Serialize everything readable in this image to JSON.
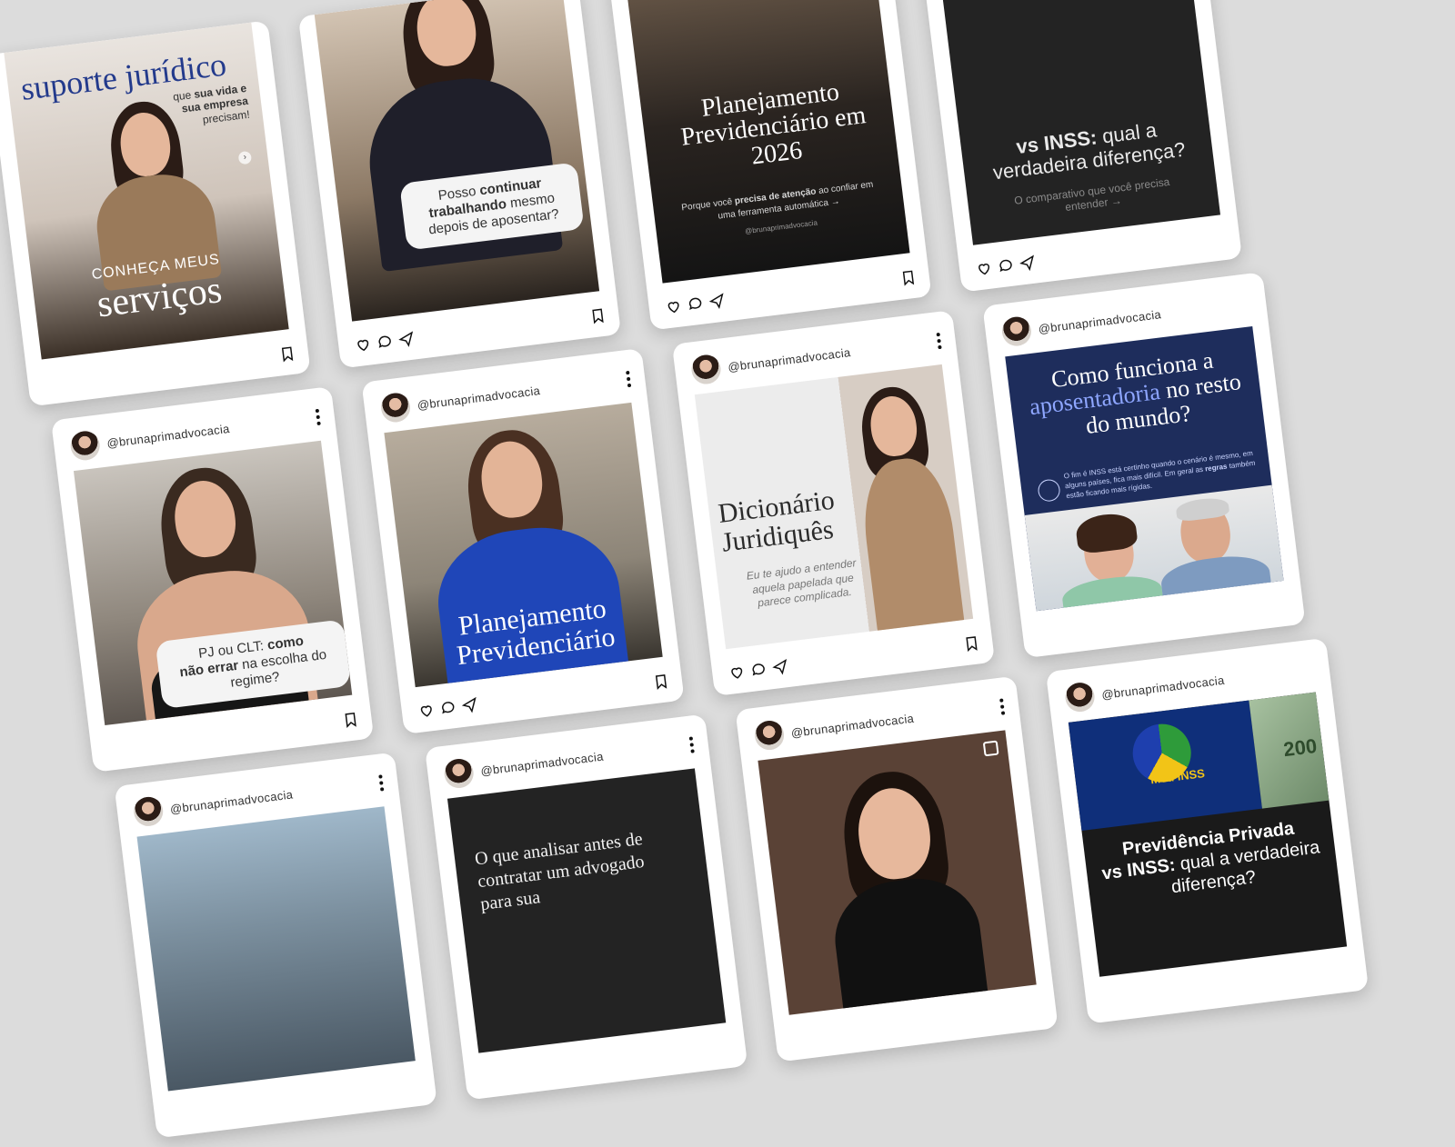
{
  "handle": "@brunaprimadvocacia",
  "colors": {
    "background": "#dcdcdc",
    "card": "#ffffff",
    "navy": "#1e2d5c",
    "dark": "#232323",
    "highlight": "#8ea6ff"
  },
  "icons": [
    "heart-icon",
    "comment-icon",
    "share-icon",
    "bookmark-icon",
    "more-icon",
    "carousel-icon",
    "globe-icon"
  ],
  "posts": {
    "p1": {
      "title": "suporte jurídico",
      "sub_lead": "que ",
      "sub_bold": "sua vida e sua empresa",
      "sub_tail": " precisam!",
      "caption_small": "CONHEÇA MEUS",
      "caption_big": "serviços"
    },
    "p2": {
      "q1": "Posso ",
      "q2": "continuar trabalhando",
      "q3": " mesmo depois de aposentar?"
    },
    "p3": {
      "title": "Planejamento Previdenciário em 2026",
      "sub_lead": "Porque você ",
      "sub_bold": "precisa de atenção",
      "sub_tail": " ao confiar em uma ferramenta automática →",
      "credit": "@brunaprimadvocacia"
    },
    "p4": {
      "title_bold": "vs INSS:",
      "title_rest": " qual a verdadeira diferença?",
      "sub": "O comparativo que você precisa entender →"
    },
    "p5": {
      "q_lead": "PJ ou CLT: ",
      "q_bold1": "como",
      "q_bold2": "não errar",
      "q_tail": " na escolha do regime?"
    },
    "p6": {
      "caption": "Planejamento Previdenciário"
    },
    "p7": {
      "title": "Dicionário Juridiquês",
      "sub": "Eu te ajudo a entender aquela papelada que parece complicada."
    },
    "p8": {
      "title_lead": "Como funciona a",
      "title_highlight": "aposentadoria",
      "title_tail": " no resto do mundo?",
      "info_lead": "O fim é INSS está certinho quando o cenário é mesmo, em alguns países, fica mais difícil. Em geral as ",
      "info_bold": "regras",
      "info_tail": " também estão ficando mais rígidas."
    },
    "p9": {},
    "p10": {
      "text": "O que analisar antes de contratar um advogado para sua"
    },
    "p11": {},
    "p12": {
      "app_label": "Meu INSS",
      "note_value": "200",
      "title_bold": "Previdência Privada",
      "vs_bold": "vs INSS:",
      "vs_rest": " qual a verdadeira diferença?"
    }
  }
}
